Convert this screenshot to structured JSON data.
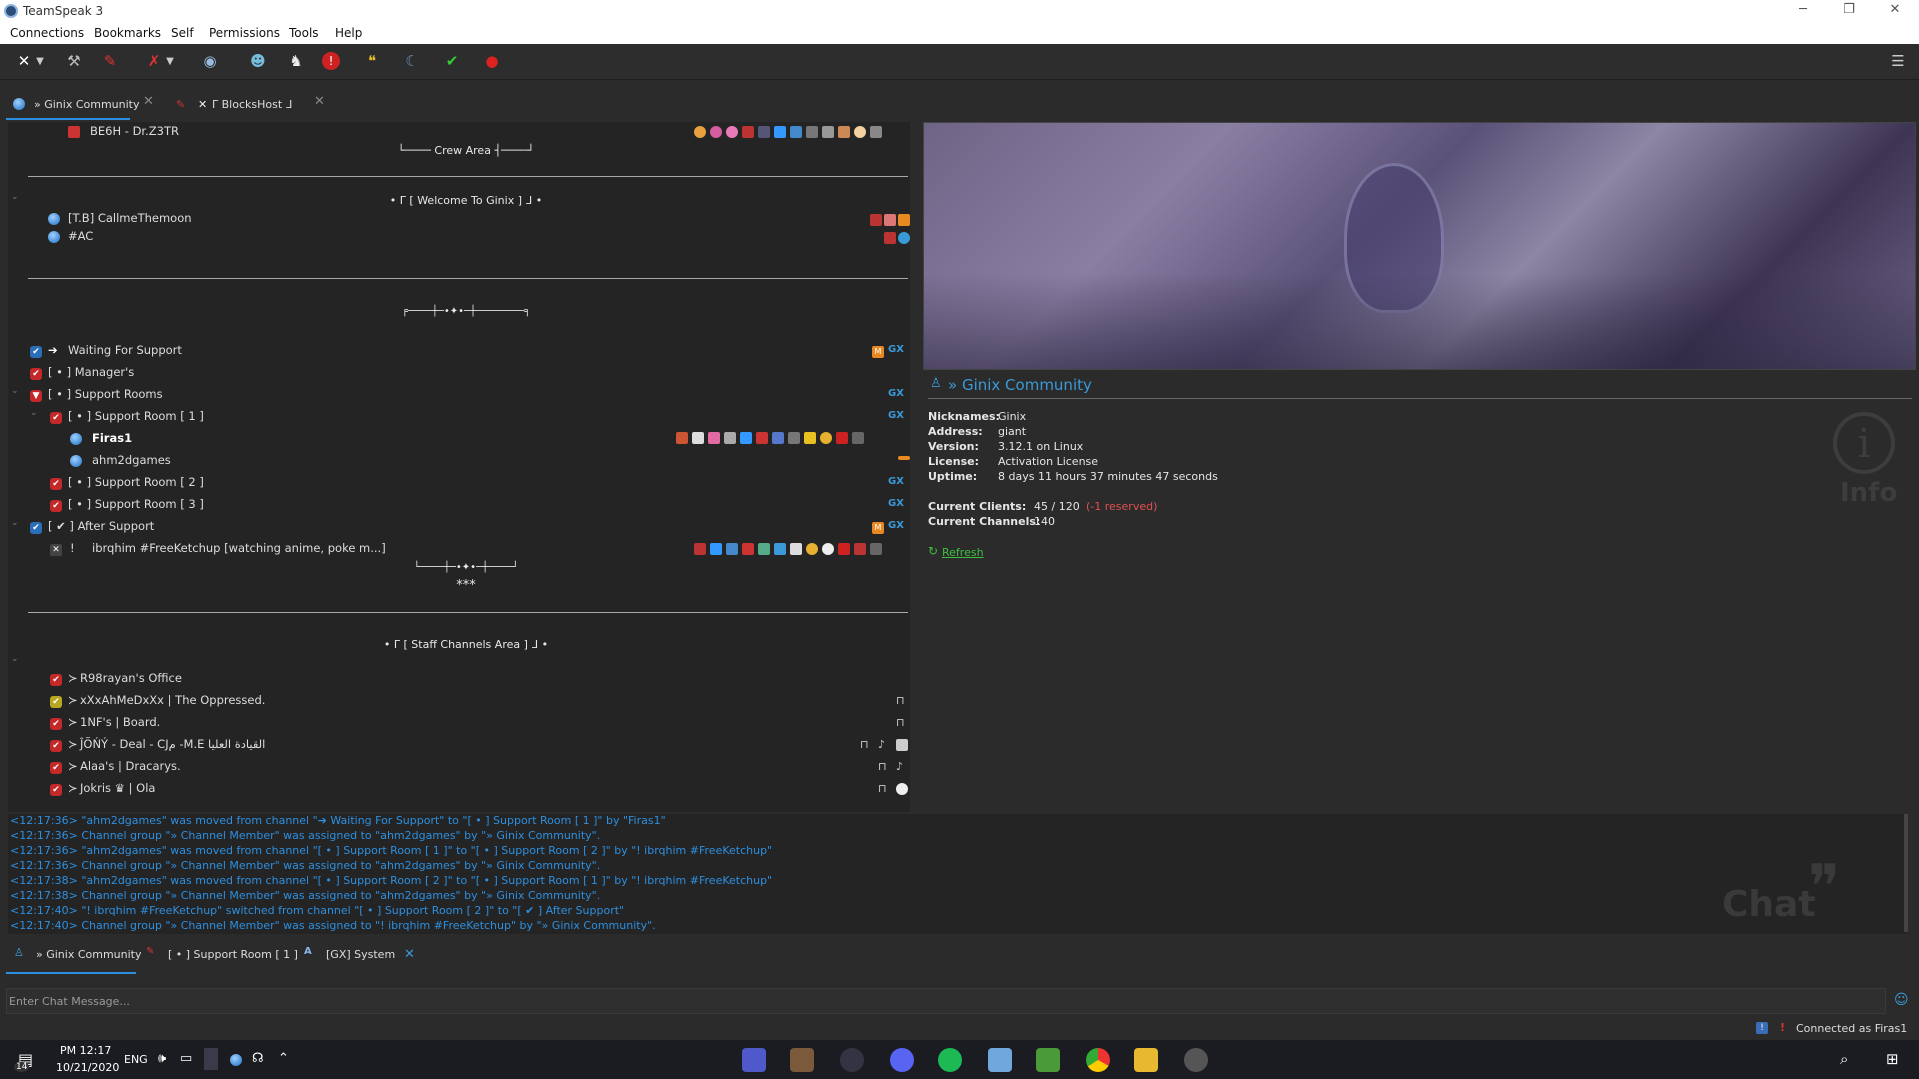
{
  "window": {
    "title": "TeamSpeak 3"
  },
  "menu": [
    "Connections",
    "Bookmarks",
    "Self",
    "Permissions",
    "Tools",
    "Help"
  ],
  "tabs": [
    {
      "label": "» Ginix Community",
      "active": true
    },
    {
      "label": "ᒥ BlocksHost ᒧ",
      "active": false
    }
  ],
  "tree": {
    "top_user": "BE6H - Dr.Z3TR",
    "crew_area": "└──── Crew Area ┤────┘",
    "welcome": "• ᒥ [ Welcome To Ginix ] ᒧ •",
    "users_welcome": [
      "[T.B] CallmeThemoon",
      "#AC"
    ],
    "spacer_deco": "╒────┼─•✦•─┼────────╕",
    "channels": [
      {
        "label": "Waiting For Support",
        "badges": [
          "M",
          "GX"
        ]
      },
      {
        "label": "[ • ] Manager's"
      },
      {
        "label": "[ • ] Support Rooms",
        "badges": [
          "GX"
        ]
      },
      {
        "label": "[ • ] Support Room [ 1 ]",
        "badges": [
          "GX"
        ]
      },
      {
        "label": "[ • ] Support Room [ 2 ]",
        "badges": [
          "GX"
        ]
      },
      {
        "label": "[ • ] Support Room [ 3 ]",
        "badges": [
          "GX"
        ]
      },
      {
        "label": "[ ✔ ] After Support",
        "badges": [
          "M",
          "GX"
        ]
      }
    ],
    "support_room_1_users": [
      "Firas1",
      "ahm2dgames"
    ],
    "after_support_user": "ibrqhim #FreeKetchup [watching anime, poke m...]",
    "after_support_prefix": "!",
    "deco2": "└────┼─•✦•─┼────┘",
    "stars": "***",
    "staff_area": "• ᒥ [ Staff Channels Area ] ᒧ •",
    "staff_channels": [
      "R98rayan's Office",
      "xXxAhMeDxXx | The Oppressed.",
      "1NF's | Board.",
      "ĴÕŃÝ - Deal - CJم -M.E القيادة العليا",
      "Alaa's | Dracarys.",
      "Jokris ♛ | Ola"
    ]
  },
  "server_info": {
    "name": "» Ginix Community",
    "nicknames_label": "Nicknames:",
    "nicknames": "Ginix",
    "address_label": "Address:",
    "address": "giant",
    "version_label": "Version:",
    "version": "3.12.1 on Linux",
    "license_label": "License:",
    "license": "Activation License",
    "uptime_label": "Uptime:",
    "uptime": "8 days 11 hours 37 minutes 47 seconds",
    "clients_label": "Current Clients:",
    "clients": "45 / 120",
    "clients_reserved": "(-1 reserved)",
    "channels_label": "Current Channels:",
    "channels": "140",
    "refresh": "Refresh",
    "info_watermark": "Info"
  },
  "chat_log": [
    "<12:17:36> \"ahm2dgames\" was moved from channel \"➔ Waiting For Support\" to \"[ • ] Support Room [ 1 ]\" by \"Firas1\"",
    "<12:17:36> Channel group \"» Channel Member\" was assigned to \"ahm2dgames\" by \"» Ginix Community\".",
    "<12:17:36> \"ahm2dgames\" was moved from channel \"[ • ] Support Room [ 1 ]\" to \"[ • ] Support Room [ 2 ]\" by \"!     ibrqhim #FreeKetchup\"",
    "<12:17:36> Channel group \"» Channel Member\" was assigned to \"ahm2dgames\" by \"» Ginix Community\".",
    "<12:17:38> \"ahm2dgames\" was moved from channel \"[ • ] Support Room [ 2 ]\" to \"[ • ] Support Room [ 1 ]\" by \"!     ibrqhim #FreeKetchup\"",
    "<12:17:38> Channel group \"» Channel Member\" was assigned to \"ahm2dgames\" by \"» Ginix Community\".",
    "<12:17:40> \"!     ibrqhim #FreeKetchup\" switched from channel \"[ • ] Support Room [ 2 ]\" to \"[ ✔ ] After Support\"",
    "<12:17:40> Channel group \"» Channel Member\" was assigned to \"!     ibrqhim #FreeKetchup\" by \"» Ginix Community\"."
  ],
  "chat_watermark": "Chat",
  "chat_tabs": [
    {
      "label": "» Ginix Community"
    },
    {
      "label": "[ • ] Support Room [ 1 ]"
    },
    {
      "label": "[GX] System"
    }
  ],
  "chat_input_placeholder": "Enter Chat Message...",
  "status": {
    "connected": "Connected as Firas1"
  },
  "taskbar": {
    "time": "PM 12:17",
    "date": "10/21/2020",
    "lang": "ENG",
    "notif_count": "14"
  },
  "colors": {
    "accent": "#2d8fe0",
    "channel_red": "#c42828",
    "link_green": "#3fbf3f"
  }
}
